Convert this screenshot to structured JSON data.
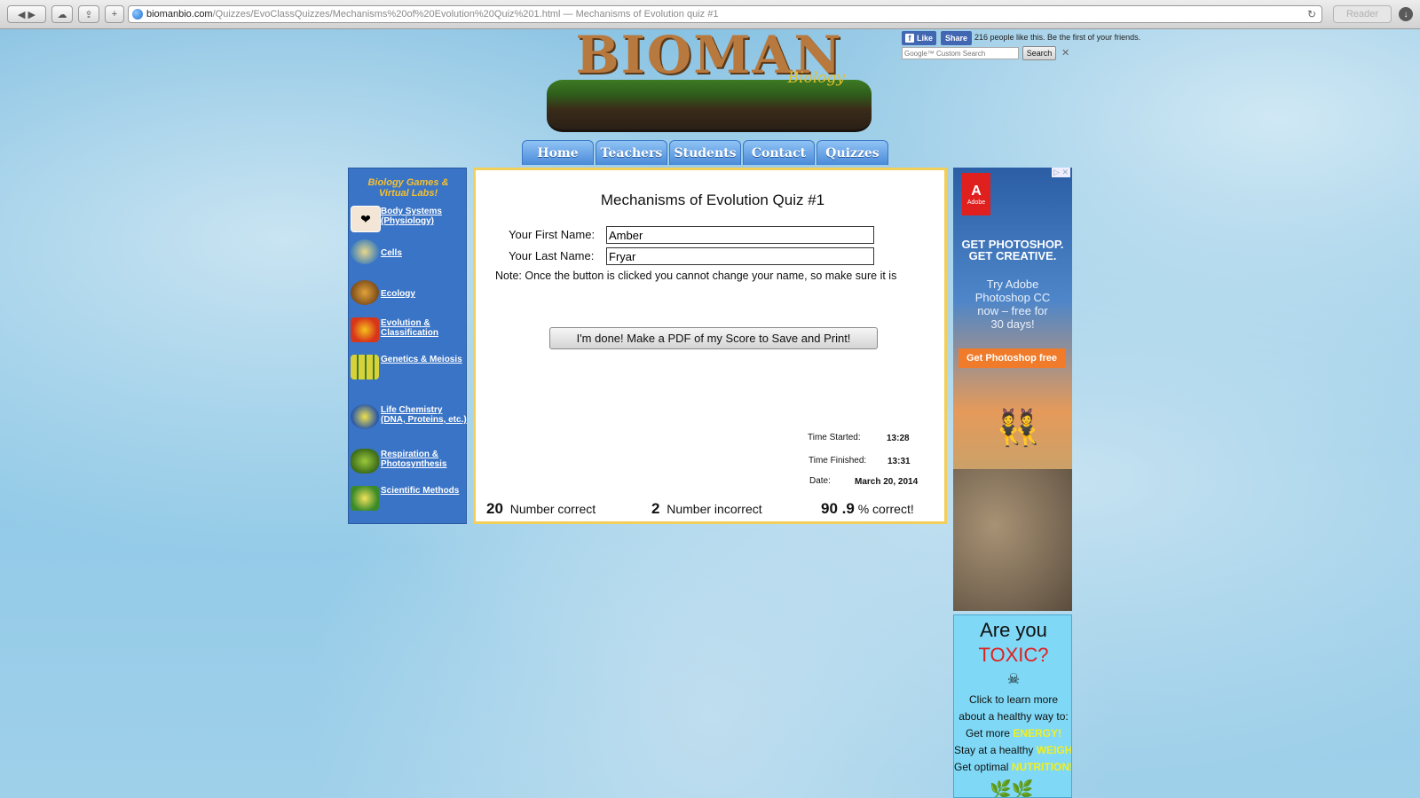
{
  "browser": {
    "url_host": "biomanbio.com",
    "url_path": "/Quizzes/EvoClassQuizzes/Mechanisms%20of%20Evolution%20Quiz%201.html",
    "url_sep": " — ",
    "page_title": "Mechanisms of Evolution quiz #1",
    "reader_label": "Reader"
  },
  "logo": {
    "letters": "BIOMAN",
    "subtitle": "Biology"
  },
  "nav": [
    "Home",
    "Teachers",
    "Students",
    "Contact",
    "Quizzes"
  ],
  "sidebar": {
    "heading": "Biology Games & Virtual Labs!",
    "items": [
      {
        "label": "Body Systems (Physiology)",
        "icon": "heart-icon"
      },
      {
        "label": "Cells",
        "icon": "cell-icon"
      },
      {
        "label": "Ecology",
        "icon": "ecology-icon"
      },
      {
        "label": "Evolution & Classification",
        "icon": "evolution-icon"
      },
      {
        "label": "Genetics & Meiosis",
        "icon": "genetics-icon"
      },
      {
        "label": "Life Chemistry (DNA, Proteins, etc.)",
        "icon": "dna-icon"
      },
      {
        "label": "Respiration & Photosynthesis",
        "icon": "leaf-icon"
      },
      {
        "label": "Scientific Methods",
        "icon": "microscope-icon"
      }
    ]
  },
  "quiz": {
    "title": "Mechanisms of Evolution Quiz #1",
    "first_name_label": "Your First Name:",
    "first_name_value": "Amber",
    "last_name_label": "Your Last Name:",
    "last_name_value": "Fryar",
    "note": "Note: Once the button is clicked you cannot change your name, so make sure it is",
    "done_button": "I'm done!  Make a PDF of my Score to Save and Print!",
    "time_started_label": "Time Started:",
    "time_started": "13:28",
    "time_finished_label": "Time Finished:",
    "time_finished": "13:31",
    "date_label": "Date:",
    "date": "March 20, 2014",
    "num_correct": "20",
    "num_correct_label": "Number correct",
    "num_incorrect": "2",
    "num_incorrect_label": "Number incorrect",
    "percent": "90 .9",
    "percent_label": "% correct!"
  },
  "facebook": {
    "like_label": "Like",
    "share_label": "Share",
    "social_text": "216 people like this. Be the first of your friends."
  },
  "search": {
    "placeholder": "Google™ Custom Search",
    "button": "Search"
  },
  "ad_adobe": {
    "logo_sub": "Adobe",
    "headline_1": "GET PHOTOSHOP.",
    "headline_2": "GET CREATIVE.",
    "body_1": "Try Adobe",
    "body_2": "Photoshop CC",
    "body_3": "now – free for",
    "body_4": "30 days!",
    "cta": "Get Photoshop free"
  },
  "ad_toxic": {
    "question": "Are you",
    "toxic": "TOXIC?",
    "line1": "Click to learn more",
    "line2": "about a healthy way to:",
    "line3_pre": "Get more ",
    "line3_hl": "ENERGY!",
    "line4_pre": "Stay at a healthy ",
    "line4_hl": "WEIGHT!",
    "line5_pre": "Get optimal ",
    "line5_hl": "NUTRITION!"
  }
}
